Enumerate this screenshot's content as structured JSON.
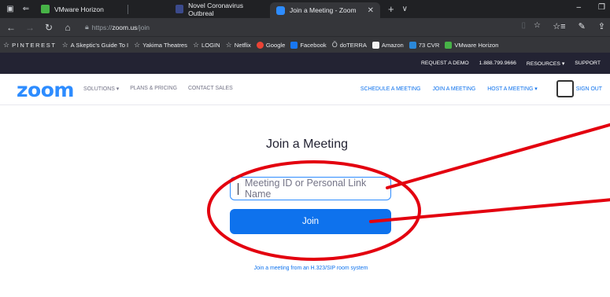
{
  "browser": {
    "tabs": [
      {
        "label": "VMware Horizon",
        "icon": "vmware-icon",
        "color": "#47b347"
      },
      {
        "label": "Novel Coronavirus Outbreal",
        "icon": "news-favicon",
        "color": "#3b4a8c"
      },
      {
        "label": "Join a Meeting - Zoom",
        "icon": "zoom-favicon",
        "color": "#2d8cff",
        "active": true
      }
    ],
    "url_prefix": "https://",
    "url_host": "zoom.us",
    "url_path": "/join",
    "favorites": [
      {
        "label": "PINTEREST",
        "icon": "star-icon"
      },
      {
        "label": "A Skeptic's Guide To I",
        "icon": "star-icon"
      },
      {
        "label": "Yakima Theatres",
        "icon": "star-icon"
      },
      {
        "label": "LOGIN",
        "icon": "star-icon"
      },
      {
        "label": "Netflix",
        "icon": "star-icon"
      },
      {
        "label": "Google",
        "icon": "google-icon"
      },
      {
        "label": "Facebook",
        "icon": "facebook-icon"
      },
      {
        "label": "doTERRA",
        "icon": "doterra-icon"
      },
      {
        "label": "Amazon",
        "icon": "amazon-icon"
      },
      {
        "label": "73 CVR",
        "icon": "cvr-icon"
      },
      {
        "label": "VMware Horizon",
        "icon": "vmware-icon"
      }
    ]
  },
  "zoom": {
    "util": {
      "request_demo": "REQUEST A DEMO",
      "phone": "1.888.799.9666",
      "resources": "RESOURCES ▾",
      "support": "SUPPORT"
    },
    "logo": "zoom",
    "nav_left": [
      "SOLUTIONS ▾",
      "PLANS & PRICING",
      "CONTACT SALES"
    ],
    "nav_right": [
      "SCHEDULE A MEETING",
      "JOIN A MEETING",
      "HOST A MEETING ▾",
      "SIGN OUT"
    ],
    "heading": "Join a Meeting",
    "input_placeholder": "Meeting ID or Personal Link Name",
    "join_label": "Join",
    "h323_link": "Join a meeting from an H.323/SIP room system"
  },
  "colors": {
    "accent": "#0e72ed",
    "brand": "#2d8cff",
    "annotation": "#e3000f"
  }
}
